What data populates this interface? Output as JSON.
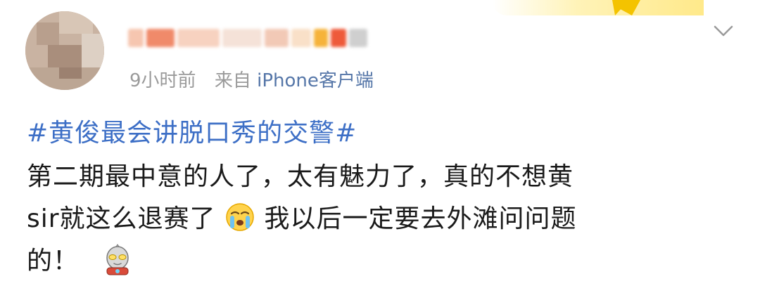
{
  "post": {
    "author_name": "",
    "time": "9小时前",
    "from_label": "来自",
    "source": "iPhone客户端",
    "topic": "#黄俊最会讲脱口秀的交警#",
    "body_lines": [
      "第二期最中意的人了，太有魅力了，真的不想黄",
      "sir就这么退赛了",
      "我以后一定要去外滩问问题",
      "的！"
    ]
  },
  "icons": {
    "more": "chevron-down-icon",
    "crying": "crying-face-emoji",
    "ultraman": "ultraman-emoji"
  },
  "colors": {
    "topic": "#3d6fc6",
    "meta": "#9a9a9a",
    "body": "#1a1a1a",
    "source": "#5576a8"
  }
}
